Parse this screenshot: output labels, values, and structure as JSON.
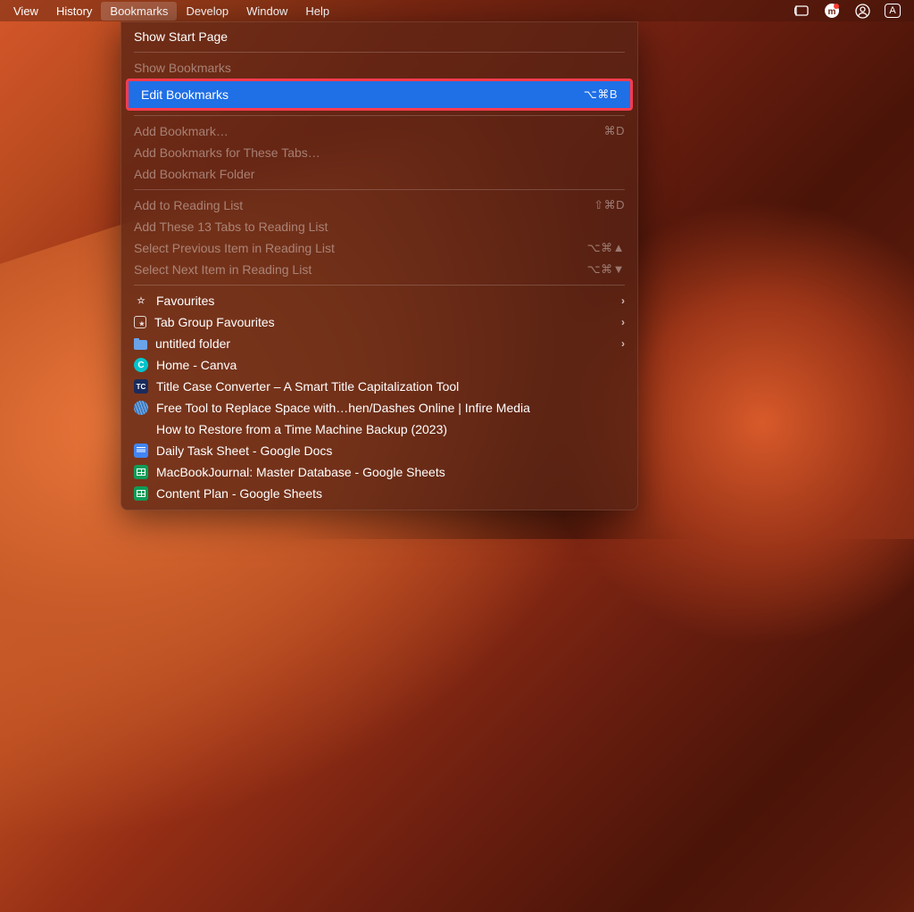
{
  "menubar": {
    "items": [
      {
        "label": "View"
      },
      {
        "label": "History"
      },
      {
        "label": "Bookmarks",
        "active": true
      },
      {
        "label": "Develop"
      },
      {
        "label": "Window"
      },
      {
        "label": "Help"
      }
    ]
  },
  "dropdown": {
    "sections": {
      "show_start": "Show Start Page",
      "show_bookmarks": "Show Bookmarks",
      "edit_bookmarks": {
        "label": "Edit Bookmarks",
        "shortcut": "⌥⌘B"
      },
      "add_bookmark": {
        "label": "Add Bookmark…",
        "shortcut": "⌘D"
      },
      "add_bookmarks_tabs": "Add Bookmarks for These Tabs…",
      "add_bookmark_folder": "Add Bookmark Folder",
      "add_reading": {
        "label": "Add to Reading List",
        "shortcut": "⇧⌘D"
      },
      "add_these_tabs": "Add These 13 Tabs to Reading List",
      "select_prev": {
        "label": "Select Previous Item in Reading List",
        "shortcut": "⌥⌘▲"
      },
      "select_next": {
        "label": "Select Next Item in Reading List",
        "shortcut": "⌥⌘▼"
      }
    },
    "bookmarks": [
      {
        "icon": "star",
        "label": "Favourites",
        "sub": true
      },
      {
        "icon": "tabgroup",
        "label": "Tab Group Favourites",
        "sub": true
      },
      {
        "icon": "folder",
        "label": "untitled folder",
        "sub": true
      },
      {
        "icon": "canva",
        "label": "Home - Canva"
      },
      {
        "icon": "tc",
        "label": "Title Case Converter – A Smart Title Capitalization Tool"
      },
      {
        "icon": "globe",
        "label": "Free Tool to Replace Space with…hen/Dashes Online | Infire Media"
      },
      {
        "icon": "apple",
        "label": "How to Restore from a Time Machine Backup (2023)"
      },
      {
        "icon": "docs",
        "label": "Daily Task Sheet - Google Docs"
      },
      {
        "icon": "sheets",
        "label": "MacBookJournal: Master Database - Google Sheets"
      },
      {
        "icon": "sheets",
        "label": "Content Plan - Google Sheets"
      }
    ]
  }
}
